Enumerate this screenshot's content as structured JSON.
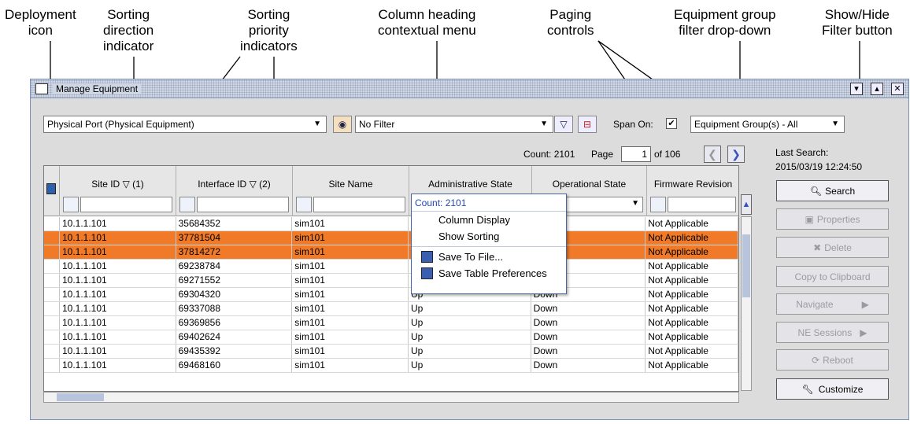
{
  "callouts": {
    "deployment_icon": "Deployment\nicon",
    "sort_direction": "Sorting\ndirection\nindicator",
    "sort_priority": "Sorting\npriority\nindicators",
    "column_menu": "Column heading\ncontextual menu",
    "paging": "Paging\ncontrols",
    "group_filter": "Equipment group\nfilter drop-down",
    "show_hide": "Show/Hide\nFilter button"
  },
  "window": {
    "title": "Manage Equipment"
  },
  "toolbar": {
    "object_type": "Physical Port (Physical Equipment)",
    "filter": "No Filter",
    "span_label": "Span On:",
    "span_checked": "✔",
    "equipment_group": "Equipment Group(s) - All"
  },
  "paging": {
    "count_label": "Count: 2101",
    "page_label": "Page",
    "page_value": "1",
    "of_label": "of 106"
  },
  "last_search": {
    "label": "Last Search:",
    "value": "2015/03/19 12:24:50"
  },
  "columns": [
    {
      "label": "Site ID",
      "sort": "▽ (1)"
    },
    {
      "label": "Interface ID",
      "sort": "▽ (2)"
    },
    {
      "label": "Site Name",
      "sort": ""
    },
    {
      "label": "Administrative State",
      "sort": ""
    },
    {
      "label": "Operational State",
      "sort": ""
    },
    {
      "label": "Firmware Revision",
      "sort": ""
    }
  ],
  "rows": [
    {
      "site_id": "10.1.1.101",
      "interface_id": "35684352",
      "site_name": "sim101",
      "admin": "U",
      "oper": "",
      "fw": "Not Applicable",
      "selected": false
    },
    {
      "site_id": "10.1.1.101",
      "interface_id": "37781504",
      "site_name": "sim101",
      "admin": "U",
      "oper": "",
      "fw": "Not Applicable",
      "selected": true
    },
    {
      "site_id": "10.1.1.101",
      "interface_id": "37814272",
      "site_name": "sim101",
      "admin": "U",
      "oper": "",
      "fw": "Not Applicable",
      "selected": true
    },
    {
      "site_id": "10.1.1.101",
      "interface_id": "69238784",
      "site_name": "sim101",
      "admin": "U",
      "oper": "",
      "fw": "Not Applicable",
      "selected": false
    },
    {
      "site_id": "10.1.1.101",
      "interface_id": "69271552",
      "site_name": "sim101",
      "admin": "U",
      "oper": "",
      "fw": "Not Applicable",
      "selected": false
    },
    {
      "site_id": "10.1.1.101",
      "interface_id": "69304320",
      "site_name": "sim101",
      "admin": "Up",
      "oper": "Down",
      "fw": "Not Applicable",
      "selected": false
    },
    {
      "site_id": "10.1.1.101",
      "interface_id": "69337088",
      "site_name": "sim101",
      "admin": "Up",
      "oper": "Down",
      "fw": "Not Applicable",
      "selected": false
    },
    {
      "site_id": "10.1.1.101",
      "interface_id": "69369856",
      "site_name": "sim101",
      "admin": "Up",
      "oper": "Down",
      "fw": "Not Applicable",
      "selected": false
    },
    {
      "site_id": "10.1.1.101",
      "interface_id": "69402624",
      "site_name": "sim101",
      "admin": "Up",
      "oper": "Down",
      "fw": "Not Applicable",
      "selected": false
    },
    {
      "site_id": "10.1.1.101",
      "interface_id": "69435392",
      "site_name": "sim101",
      "admin": "Up",
      "oper": "Down",
      "fw": "Not Applicable",
      "selected": false
    },
    {
      "site_id": "10.1.1.101",
      "interface_id": "69468160",
      "site_name": "sim101",
      "admin": "Up",
      "oper": "Down",
      "fw": "Not Applicable",
      "selected": false
    }
  ],
  "context_menu": {
    "title": "Count: 2101",
    "items": [
      "Column Display",
      "Show Sorting",
      "Save To File...",
      "Save Table Preferences"
    ]
  },
  "side_buttons": {
    "search": "Search",
    "properties": "Properties",
    "delete": "Delete",
    "copy": "Copy to Clipboard",
    "navigate": "Navigate",
    "ne_sessions": "NE Sessions",
    "reboot": "Reboot",
    "customize": "Customize"
  },
  "colors": {
    "selected_row": "#f07a28",
    "menu_title": "#2448b0"
  }
}
